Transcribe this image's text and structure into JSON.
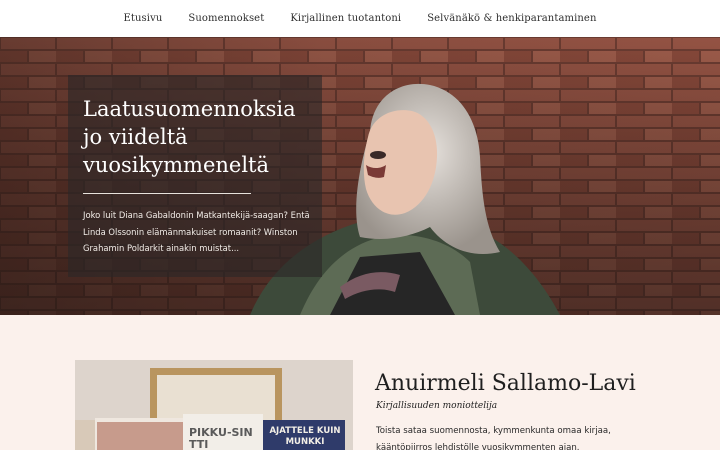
{
  "nav": {
    "items": [
      {
        "label": "Etusivu"
      },
      {
        "label": "Suomennokset"
      },
      {
        "label": "Kirjallinen tuotantoni"
      },
      {
        "label": "Selvänäkö & henkiparantaminen"
      }
    ]
  },
  "hero": {
    "title": "Laatusuomennoksia jo viideltä vuosikymmeneltä",
    "text": "Joko luit Diana Gabaldonin Matkantekijä-saagan? Entä Linda Olssonin elämänmakuiset romaanit? Winston Grahamin Poldarkit ainakin muistat..."
  },
  "about": {
    "name": "Anuirmeli Sallamo-Lavi",
    "subtitle": "Kirjallisuuden moniottelija",
    "bio": "Toista sataa suomennosta, kymmenkunta omaa kirjaa, kääntöpiirros lehdistölle vuosikymmenten ajan.",
    "books": [
      "PIKKU-SINTTI",
      "AJATTELE KUIN MUNKKI"
    ]
  },
  "colors": {
    "brick": "#8a4a3a",
    "panel": "#2c2626",
    "about_bg": "#fbf1ec"
  }
}
